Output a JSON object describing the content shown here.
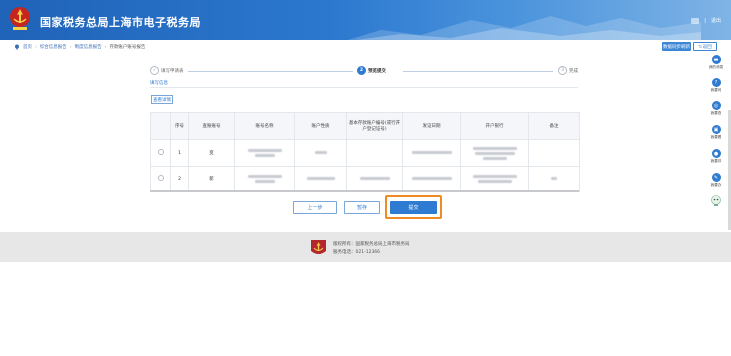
{
  "header": {
    "title": "国家税务总局上海市电子税务局",
    "right_sep": "|",
    "right_link": "退出"
  },
  "breadcrumb": {
    "items": [
      "首页",
      "综合信息报告",
      "制度信息报告",
      "存款账户账号报告"
    ]
  },
  "top_buttons": {
    "refresh": "数据同步刷新",
    "back": "返回"
  },
  "sidebar": {
    "items": [
      {
        "label": "我的消息",
        "icon": "message-icon"
      },
      {
        "label": "我要问",
        "icon": "ask-icon"
      },
      {
        "label": "我要查",
        "icon": "search-icon"
      },
      {
        "label": "我要看",
        "icon": "view-icon"
      },
      {
        "label": "我要评",
        "icon": "rate-icon"
      },
      {
        "label": "我要办",
        "icon": "handle-icon"
      }
    ]
  },
  "steps": [
    {
      "num": "✓",
      "label": "填写申请表",
      "state": "done"
    },
    {
      "num": "2",
      "label": "预览提交",
      "state": "active"
    },
    {
      "num": "3",
      "label": "完成",
      "state": "todo"
    }
  ],
  "subtab": "填写信息",
  "small_button": "查看详情",
  "table": {
    "headers": [
      "",
      "序号",
      "查账账号",
      "账号名称",
      "账户性质",
      "基本存款账户编号(或行开户登记证号)",
      "发证日期",
      "开户银行",
      "备注"
    ],
    "rows": [
      {
        "seq": "1",
        "col2": "变"
      },
      {
        "seq": "2",
        "col2": "新"
      }
    ]
  },
  "actions": {
    "prev": "上一步",
    "save": "暂存",
    "submit": "提交"
  },
  "footer": {
    "line1": "版权所有：国家税务总局上海市税务局",
    "line2": "服务电话：021-12366"
  },
  "colors": {
    "primary": "#2e7bd1",
    "highlight_frame": "#f08a24",
    "header_start": "#1f63b8"
  }
}
